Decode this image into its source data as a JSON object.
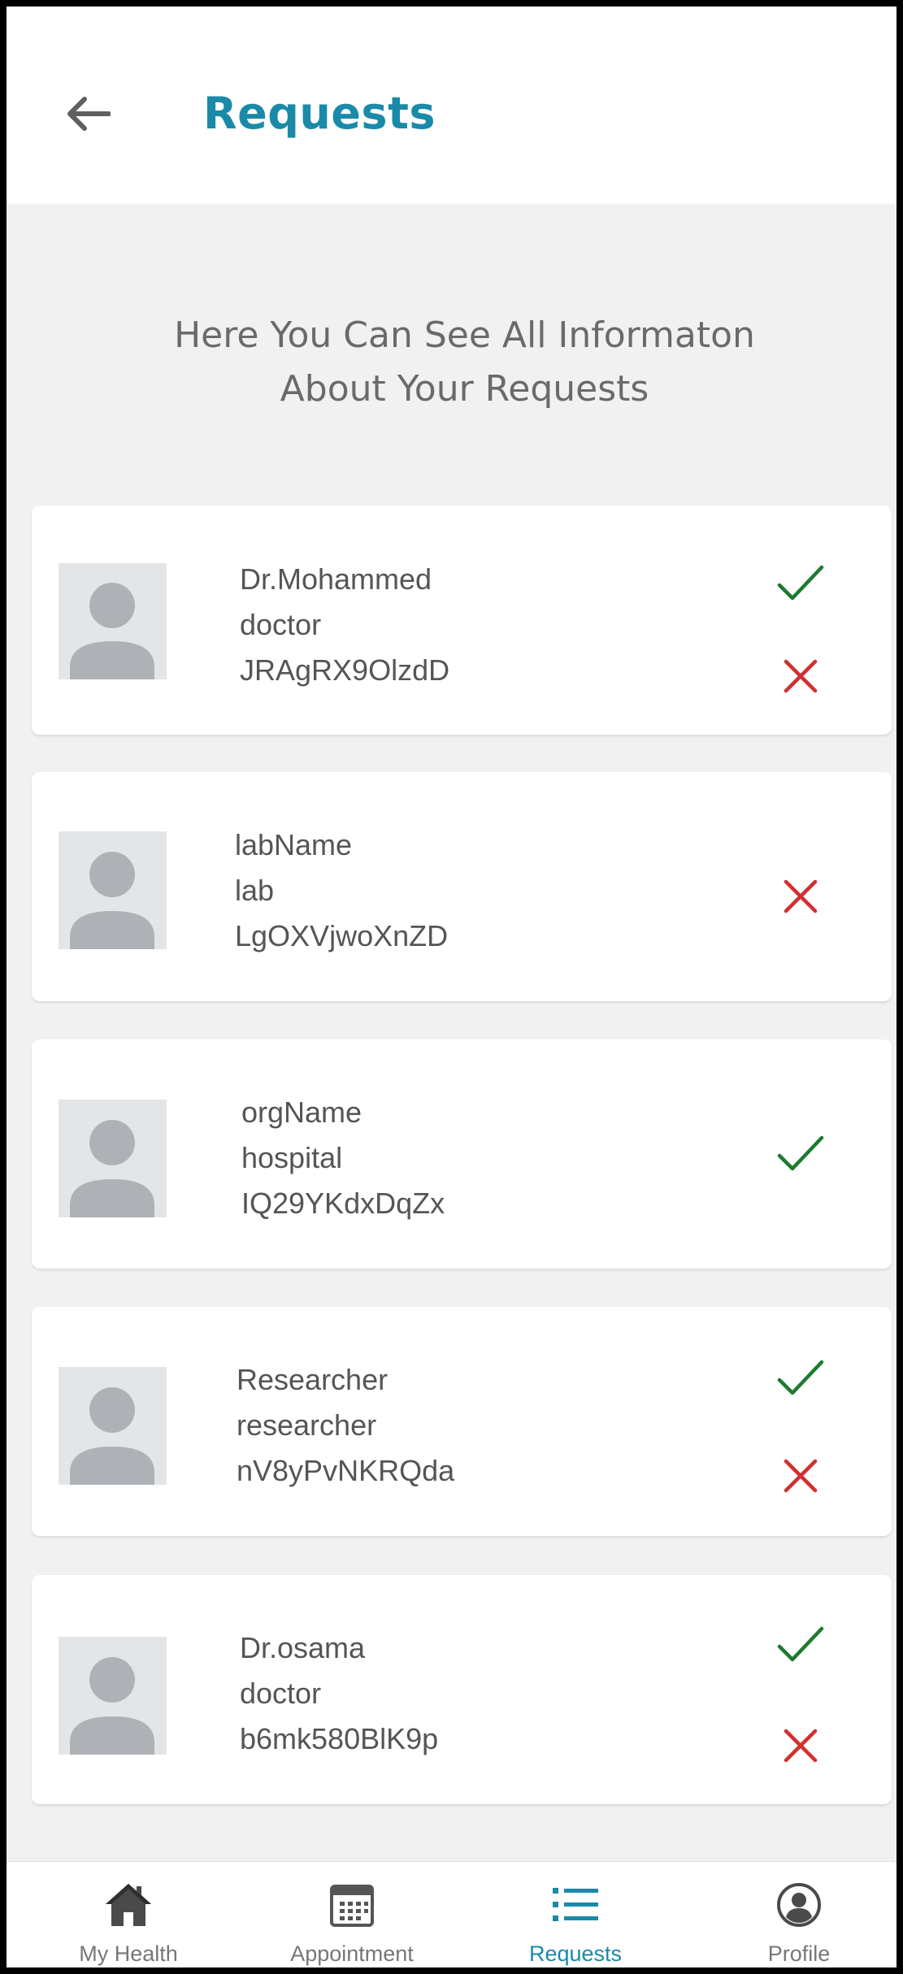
{
  "header": {
    "title": "Requests",
    "back_icon": "arrow-left-icon"
  },
  "intro": {
    "line1": "Here You Can See All Informaton",
    "line2": "About Your Requests"
  },
  "colors": {
    "accent": "#1a8aa8",
    "accept": "#1e7a2e",
    "reject": "#d32f2f",
    "background": "#f1f1f1",
    "avatar_bg": "#e3e5e7",
    "avatar_fg": "#aeb2b6"
  },
  "requests": [
    {
      "name": "Dr.Mohammed",
      "type": "doctor",
      "id": "JRAgRX9OlzdD",
      "can_accept": true,
      "can_reject": true
    },
    {
      "name": "labName",
      "type": "lab",
      "id": "LgOXVjwoXnZD",
      "can_accept": false,
      "can_reject": true
    },
    {
      "name": "orgName",
      "type": "hospital",
      "id": "IQ29YKdxDqZx",
      "can_accept": true,
      "can_reject": false
    },
    {
      "name": "Researcher",
      "type": "researcher",
      "id": "nV8yPvNKRQda",
      "can_accept": true,
      "can_reject": true
    },
    {
      "name": "Dr.osama",
      "type": "doctor",
      "id": "b6mk580BlK9p",
      "can_accept": true,
      "can_reject": true
    }
  ],
  "nav": {
    "items": [
      {
        "label": "My Health",
        "icon": "home-icon",
        "active": false
      },
      {
        "label": "Appointment",
        "icon": "calendar-icon",
        "active": false
      },
      {
        "label": "Requests",
        "icon": "list-icon",
        "active": true
      },
      {
        "label": "Profile",
        "icon": "profile-icon",
        "active": false
      }
    ]
  }
}
